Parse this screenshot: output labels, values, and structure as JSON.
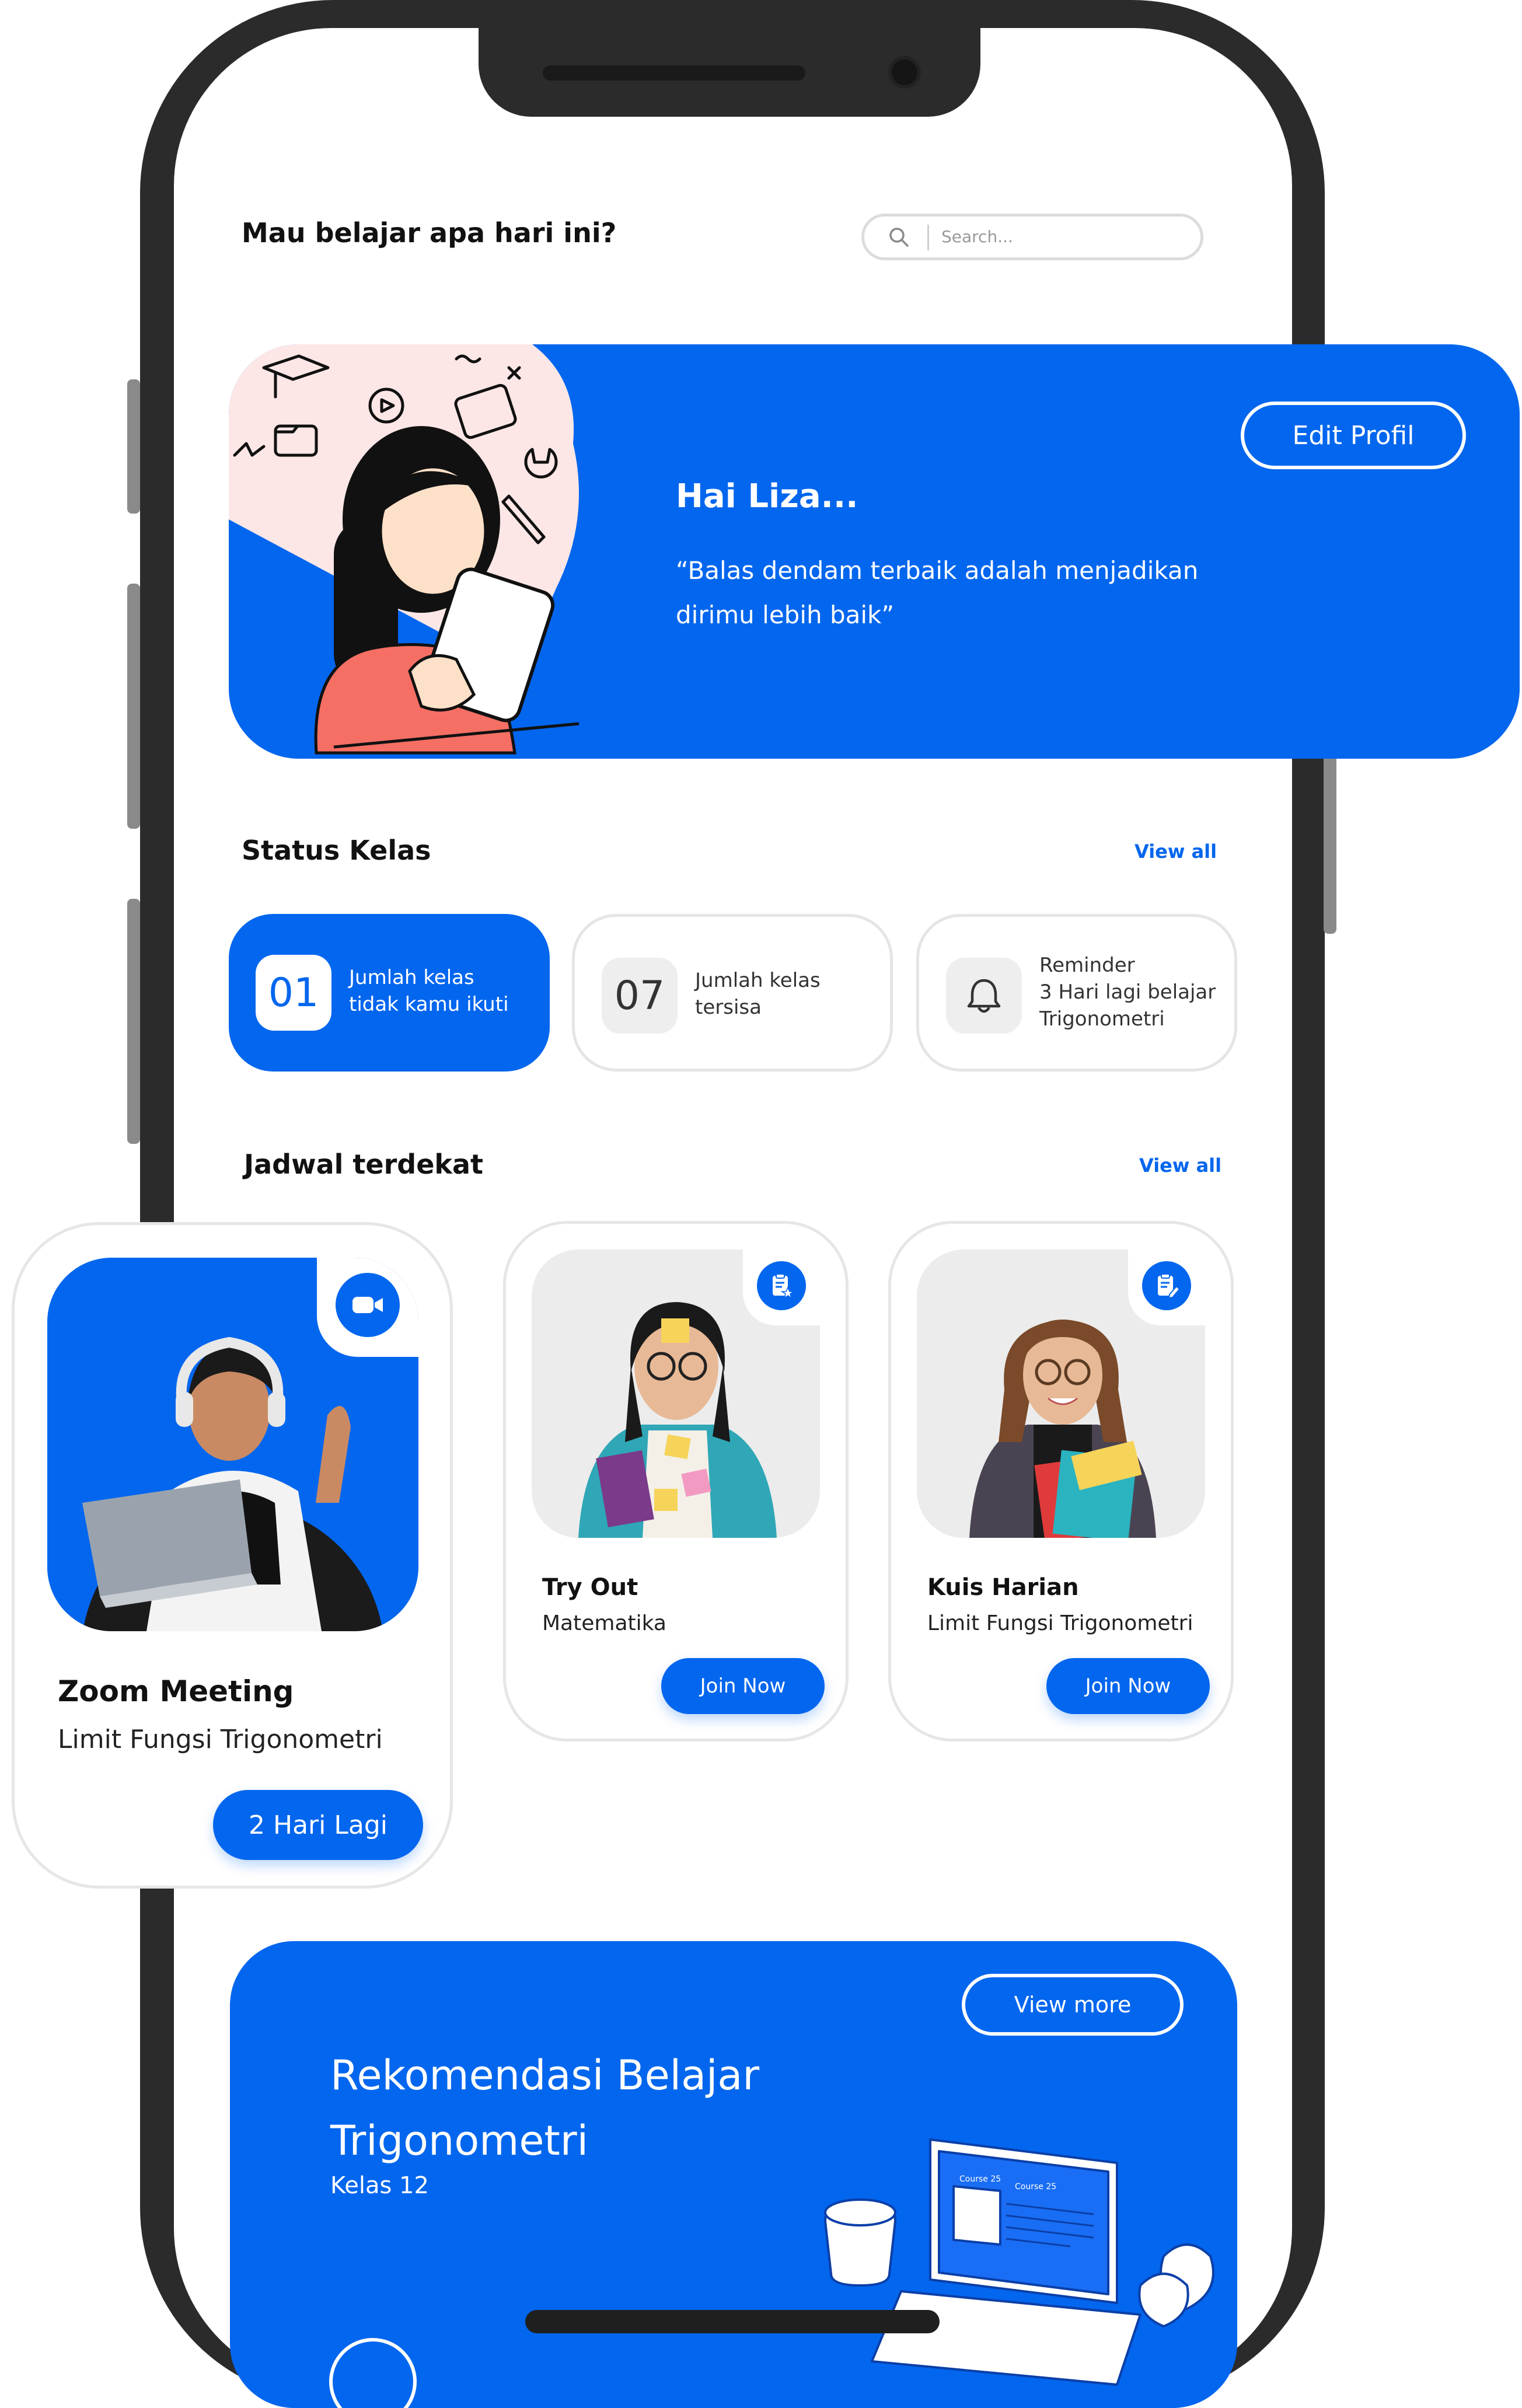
{
  "header": {
    "greeting": "Mau belajar apa hari ini?",
    "search_placeholder": "Search..."
  },
  "hero": {
    "title": "Hai Liza...",
    "quote_line1": "“Balas dendam terbaik adalah menjadikan",
    "quote_line2": "dirimu lebih baik”",
    "edit_button": "Edit Profil"
  },
  "status": {
    "title": "Status Kelas",
    "view_all": "View all",
    "cards": [
      {
        "number": "01",
        "line1": "Jumlah kelas",
        "line2": "tidak kamu ikuti"
      },
      {
        "number": "07",
        "line1": "Jumlah kelas",
        "line2": "tersisa"
      },
      {
        "icon": "bell-icon",
        "line1": "Reminder",
        "line2": "3 Hari lagi belajar",
        "line3": "Trigonometri"
      }
    ]
  },
  "schedule": {
    "title": "Jadwal terdekat",
    "view_all": "View all",
    "items": [
      {
        "title": "Zoom Meeting",
        "subtitle": "Limit Fungsi Trigonometri",
        "button": "2 Hari Lagi",
        "icon": "video-camera-icon"
      },
      {
        "title": "Try Out",
        "subtitle": "Matematika",
        "button": "Join Now",
        "icon": "clipboard-star-icon"
      },
      {
        "title": "Kuis Harian",
        "subtitle": "Limit Fungsi Trigonometri",
        "button": "Join Now",
        "icon": "clipboard-edit-icon"
      }
    ]
  },
  "recommendation": {
    "title_line1": "Rekomendasi Belajar",
    "title_line2": "Trigonometri",
    "subtitle": "Kelas 12",
    "button": "View more",
    "illustration_course_a": "Course 25",
    "illustration_course_b": "Course 25"
  },
  "colors": {
    "accent": "#0366ee",
    "frame": "#2b2b2b",
    "card_border": "#e6e6e6"
  }
}
